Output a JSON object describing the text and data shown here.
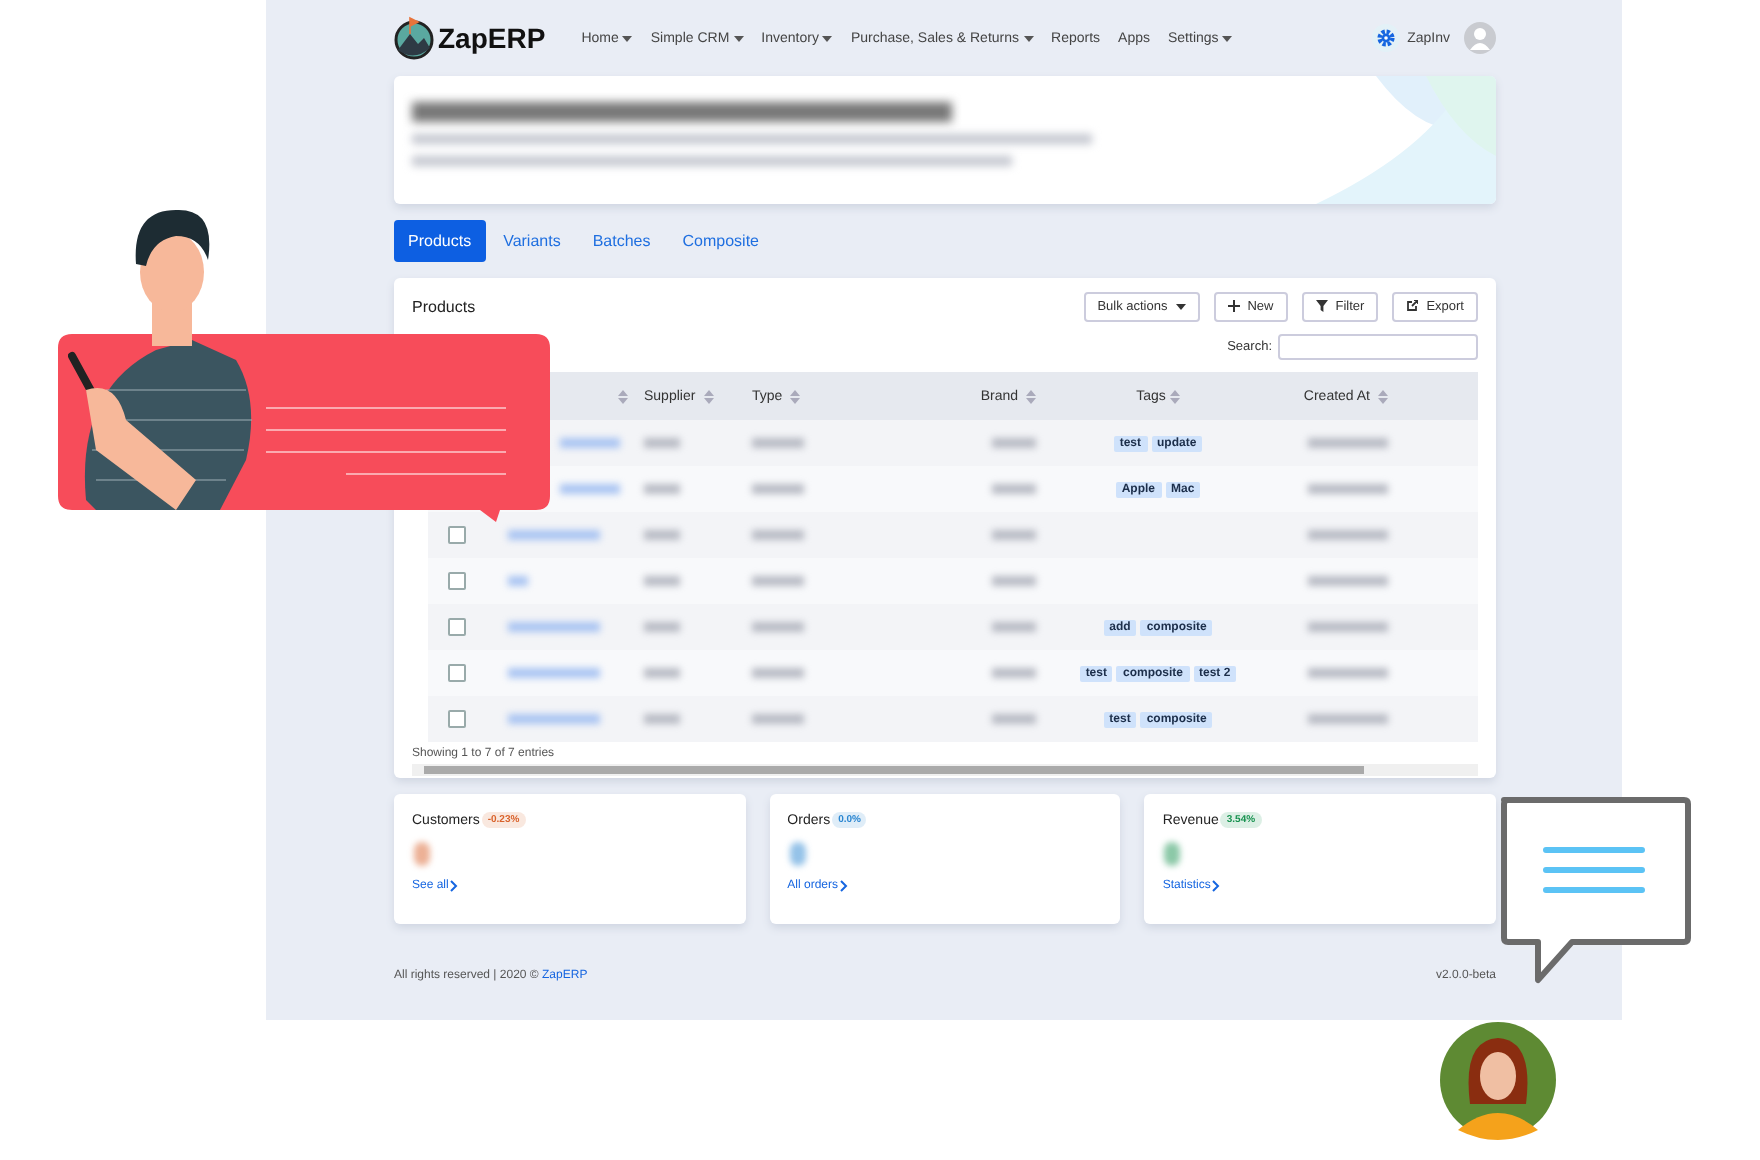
{
  "nav": {
    "brand": "ZapERP",
    "menu": [
      {
        "label": "Home",
        "dropdown": true
      },
      {
        "label": "Simple CRM",
        "dropdown": true
      },
      {
        "label": "Inventory",
        "dropdown": true
      },
      {
        "label": "Purchase, Sales & Returns",
        "dropdown": true
      },
      {
        "label": "Reports",
        "dropdown": false
      },
      {
        "label": "Apps",
        "dropdown": false
      },
      {
        "label": "Settings",
        "dropdown": true
      }
    ],
    "user": "ZapInv"
  },
  "tabs": [
    {
      "label": "Products",
      "selected": true
    },
    {
      "label": "Variants",
      "selected": false
    },
    {
      "label": "Batches",
      "selected": false
    },
    {
      "label": "Composite",
      "selected": false
    }
  ],
  "products_card": {
    "title": "Products",
    "buttons": [
      {
        "label": "Bulk actions",
        "kind": "dropdown"
      },
      {
        "label": "New",
        "kind": "new"
      },
      {
        "label": "Filter",
        "kind": "filter"
      },
      {
        "label": "Export",
        "kind": "export"
      }
    ],
    "search_label": "Search:",
    "columns": [
      "Supplier",
      "Type",
      "Brand",
      "Tags",
      "Created At"
    ],
    "rows": [
      {
        "tags": [
          "test",
          "update"
        ]
      },
      {
        "tags": [
          "Apple",
          "Mac"
        ]
      },
      {
        "checked": false,
        "tags": []
      },
      {
        "checked": false,
        "tags": []
      },
      {
        "checked": false,
        "tags": [
          "add",
          "composite"
        ]
      },
      {
        "checked": false,
        "tags": [
          "test",
          "composite",
          "test 2"
        ]
      },
      {
        "checked": false,
        "tags": [
          "test",
          "composite"
        ]
      }
    ],
    "info": "Showing 1 to 7 of 7 entries"
  },
  "stats": [
    {
      "label": "Customers",
      "change": "-0.23%",
      "color": "#d9622b",
      "link": "See all"
    },
    {
      "label": "Orders",
      "change": "0.0%",
      "color": "#2a86d1",
      "link": "All orders"
    },
    {
      "label": "Revenue",
      "change": "3.54%",
      "color": "#17924f",
      "link": "Statistics"
    }
  ],
  "footer": {
    "text": "All rights reserved | 2020 ©",
    "link": "ZapERP",
    "version": "v2.0.0-beta"
  }
}
